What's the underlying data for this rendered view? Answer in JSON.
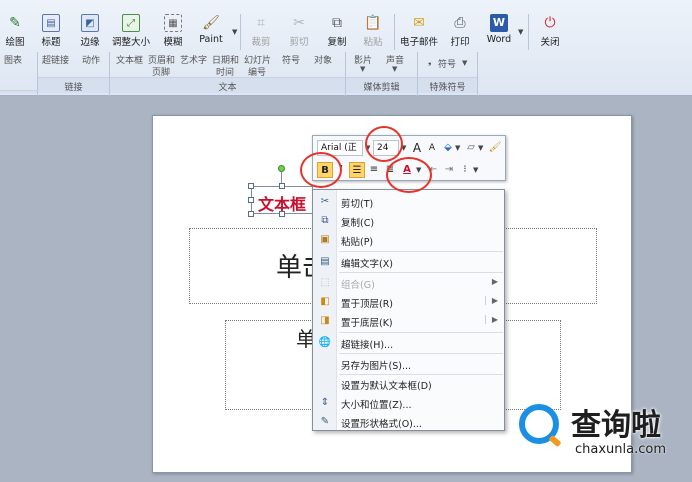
{
  "toolbar": {
    "buttons": [
      {
        "label": "绘图",
        "disabled": false
      },
      {
        "label": "标题",
        "disabled": false
      },
      {
        "label": "边缘",
        "disabled": false
      },
      {
        "label": "调整大小",
        "disabled": false
      },
      {
        "label": "模糊",
        "disabled": false
      },
      {
        "label": "Paint",
        "disabled": false
      },
      {
        "label": "裁剪",
        "disabled": true
      },
      {
        "label": "剪切",
        "disabled": true
      },
      {
        "label": "复制",
        "disabled": false
      },
      {
        "label": "粘贴",
        "disabled": true
      },
      {
        "label": "电子邮件",
        "disabled": false
      },
      {
        "label": "打印",
        "disabled": false
      },
      {
        "label": "Word",
        "disabled": false
      },
      {
        "label": "关闭",
        "disabled": false
      }
    ]
  },
  "ribbon": {
    "groups": [
      {
        "label": "",
        "items": [
          "图表"
        ]
      },
      {
        "label": "链接",
        "items": [
          "超链接",
          "动作"
        ]
      },
      {
        "label": "文本",
        "items": [
          "文本框",
          "页眉和",
          "艺术字",
          "日期和",
          "幻灯片",
          "符号",
          "对象",
          "页脚",
          "时间",
          "编号"
        ]
      },
      {
        "label": "媒体剪辑",
        "items": [
          "影片",
          "声音"
        ]
      },
      {
        "label": "特殊符号",
        "items": [
          "符号"
        ]
      }
    ]
  },
  "slide": {
    "textbox_text": "文本框",
    "placeholder1_text": "单击",
    "placeholder2_text": "单"
  },
  "mini_toolbar": {
    "font_name": "Arial (正",
    "font_size": "24",
    "bold": "B",
    "italic": "I",
    "font_color": "A",
    "grow": "A",
    "shrink": "A"
  },
  "context_menu": {
    "items": [
      {
        "label": "剪切(T)",
        "icon": "scissors-icon",
        "disabled": false
      },
      {
        "label": "复制(C)",
        "icon": "copy-icon",
        "disabled": false
      },
      {
        "label": "粘贴(P)",
        "icon": "paste-icon",
        "disabled": false
      },
      {
        "label": "编辑文字(X)",
        "icon": "text-icon",
        "disabled": false
      },
      {
        "label": "组合(G)",
        "icon": "group-icon",
        "disabled": true
      },
      {
        "label": "置于顶层(R)",
        "icon": "bring-front-icon",
        "disabled": false
      },
      {
        "label": "置于底层(K)",
        "icon": "send-back-icon",
        "disabled": false
      },
      {
        "label": "超链接(H)...",
        "icon": "hyperlink-icon",
        "disabled": false
      },
      {
        "label": "另存为图片(S)...",
        "icon": "",
        "disabled": false
      },
      {
        "label": "设置为默认文本框(D)",
        "icon": "",
        "disabled": false
      },
      {
        "label": "大小和位置(Z)...",
        "icon": "size-icon",
        "disabled": false
      },
      {
        "label": "设置形状格式(O)...",
        "icon": "format-shape-icon",
        "disabled": false
      }
    ]
  },
  "watermark": {
    "text": "查询啦",
    "url": "chaxunla.com"
  },
  "colors": {
    "accent_red": "#e5332a",
    "highlight": "#ffd46a",
    "logo_blue": "#1b8fe4"
  }
}
